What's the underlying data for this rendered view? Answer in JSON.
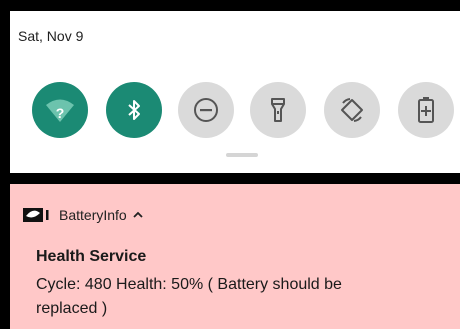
{
  "status": {
    "date": "Sat, Nov 9"
  },
  "quick_settings": {
    "tiles": [
      {
        "name": "wifi-tile",
        "icon": "wifi-question-icon",
        "state": "on"
      },
      {
        "name": "bluetooth-tile",
        "icon": "bluetooth-icon",
        "state": "on"
      },
      {
        "name": "do-not-disturb-tile",
        "icon": "minus-circle-icon",
        "state": "off"
      },
      {
        "name": "flashlight-tile",
        "icon": "flashlight-icon",
        "state": "off"
      },
      {
        "name": "auto-rotate-tile",
        "icon": "rotate-icon",
        "state": "off"
      },
      {
        "name": "battery-saver-tile",
        "icon": "battery-plus-icon",
        "state": "off"
      }
    ]
  },
  "notification": {
    "app_name": "BatteryInfo",
    "title": "Health Service",
    "line1": "Cycle: 480  Health: 50%  ( Battery should be",
    "line2": "replaced )"
  },
  "colors": {
    "accent": "#1b8a74",
    "inactive_tile": "#dadada",
    "notification_bg": "#ffc8c8"
  }
}
